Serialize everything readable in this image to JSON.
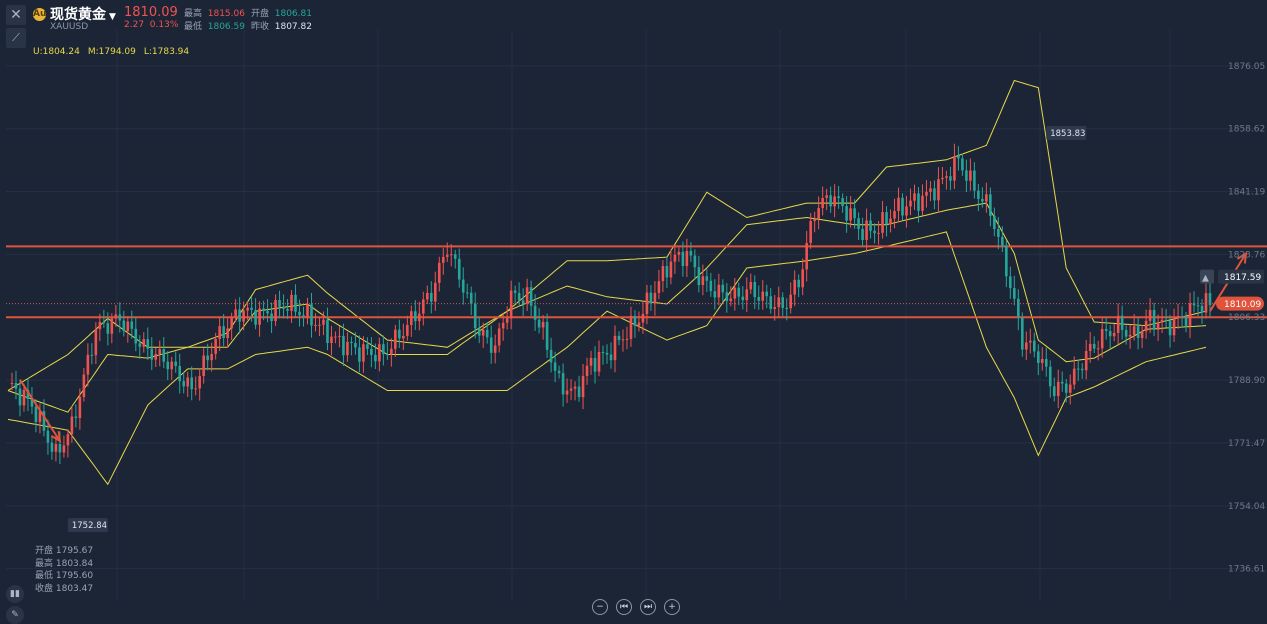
{
  "header": {
    "symbol_name": "现货黄金",
    "symbol_code": "XAUUSD",
    "coin_glyph": "Au",
    "price": "1810.09",
    "change": "2.27",
    "change_pct": "0.13%",
    "high_label": "最高",
    "high_value": "1815.06",
    "open_label": "开盘",
    "open_value": "1806.81",
    "low_label": "最低",
    "low_value": "1806.59",
    "prev_label": "昨收",
    "prev_value": "1807.82"
  },
  "bollinger": {
    "upper": "U:1804.24",
    "middle": "M:1794.09",
    "lower": "L:1783.94"
  },
  "ohlc_panel": {
    "open": "开盘 1795.67",
    "high": "最高 1803.84",
    "low": "最低 1795.60",
    "close": "收盘 1803.47"
  },
  "tags": {
    "crosshair_price": "1817.59",
    "current_price": "1810.09",
    "high_marker": "1853.83",
    "low_marker": "1752.84"
  },
  "colors": {
    "background": "#1c2536",
    "up": "#ef5350",
    "down": "#26a69a",
    "bands": "#e8d84a",
    "resistance": "#e0533d"
  },
  "icons": [
    "close-icon",
    "draw-tool-icon",
    "bell-icon",
    "zoom-out-icon",
    "scroll-start-icon",
    "scroll-end-icon",
    "zoom-in-icon"
  ],
  "chart_data": {
    "type": "candlestick",
    "symbol": "XAUUSD",
    "y_ticks": [
      "1876.05",
      "1858.62",
      "1841.19",
      "1823.76",
      "1806.33",
      "1788.90",
      "1771.47",
      "1754.04",
      "1736.61"
    ],
    "ylim": [
      1727.9,
      1886.0
    ],
    "grid": true,
    "horizontal_lines": [
      1826.0,
      1806.33
    ],
    "arrows": [
      {
        "from": [
          3,
          1789
        ],
        "to": [
          13,
          1772
        ]
      },
      {
        "from": [
          301,
          1808
        ],
        "to": [
          310,
          1824
        ]
      }
    ],
    "bands": {
      "upper": [
        [
          0,
          1786
        ],
        [
          15,
          1796
        ],
        [
          25,
          1806
        ],
        [
          35,
          1798
        ],
        [
          45,
          1798
        ],
        [
          55,
          1802
        ],
        [
          62,
          1814
        ],
        [
          75,
          1818
        ],
        [
          80,
          1813
        ],
        [
          95,
          1800
        ],
        [
          110,
          1798
        ],
        [
          125,
          1808
        ],
        [
          140,
          1822
        ],
        [
          150,
          1822
        ],
        [
          165,
          1823
        ],
        [
          175,
          1841
        ],
        [
          185,
          1834
        ],
        [
          200,
          1838
        ],
        [
          212,
          1838
        ],
        [
          220,
          1848
        ],
        [
          235,
          1850
        ],
        [
          245,
          1854
        ],
        [
          252,
          1872
        ],
        [
          258,
          1870
        ],
        [
          265,
          1820
        ],
        [
          272,
          1805
        ],
        [
          285,
          1804
        ],
        [
          300,
          1808
        ]
      ],
      "middle": [
        [
          0,
          1786
        ],
        [
          15,
          1780
        ],
        [
          25,
          1796
        ],
        [
          35,
          1795
        ],
        [
          45,
          1798
        ],
        [
          55,
          1798
        ],
        [
          62,
          1808
        ],
        [
          75,
          1810
        ],
        [
          80,
          1806
        ],
        [
          95,
          1796
        ],
        [
          110,
          1796
        ],
        [
          125,
          1808
        ],
        [
          140,
          1815
        ],
        [
          150,
          1812
        ],
        [
          165,
          1810
        ],
        [
          175,
          1820
        ],
        [
          185,
          1832
        ],
        [
          200,
          1834
        ],
        [
          212,
          1832
        ],
        [
          220,
          1832
        ],
        [
          235,
          1836
        ],
        [
          245,
          1838
        ],
        [
          252,
          1824
        ],
        [
          258,
          1800
        ],
        [
          265,
          1794
        ],
        [
          272,
          1795
        ],
        [
          285,
          1803
        ],
        [
          300,
          1804
        ]
      ],
      "lower": [
        [
          0,
          1778
        ],
        [
          15,
          1775
        ],
        [
          25,
          1760
        ],
        [
          35,
          1782
        ],
        [
          45,
          1792
        ],
        [
          55,
          1792
        ],
        [
          62,
          1796
        ],
        [
          75,
          1798
        ],
        [
          80,
          1796
        ],
        [
          95,
          1786
        ],
        [
          110,
          1786
        ],
        [
          125,
          1786
        ],
        [
          140,
          1798
        ],
        [
          150,
          1808
        ],
        [
          165,
          1800
        ],
        [
          175,
          1804
        ],
        [
          185,
          1820
        ],
        [
          200,
          1822
        ],
        [
          212,
          1824
        ],
        [
          220,
          1826
        ],
        [
          235,
          1830
        ],
        [
          245,
          1798
        ],
        [
          252,
          1784
        ],
        [
          258,
          1768
        ],
        [
          265,
          1784
        ],
        [
          272,
          1787
        ],
        [
          285,
          1794
        ],
        [
          300,
          1798
        ]
      ]
    },
    "price_path": [
      [
        0,
        1788
      ],
      [
        6,
        1782
      ],
      [
        12,
        1768
      ],
      [
        16,
        1776
      ],
      [
        22,
        1803
      ],
      [
        28,
        1806
      ],
      [
        34,
        1798
      ],
      [
        40,
        1794
      ],
      [
        46,
        1786
      ],
      [
        52,
        1800
      ],
      [
        58,
        1808
      ],
      [
        64,
        1807
      ],
      [
        70,
        1810
      ],
      [
        76,
        1806
      ],
      [
        82,
        1800
      ],
      [
        88,
        1797
      ],
      [
        94,
        1796
      ],
      [
        100,
        1804
      ],
      [
        106,
        1813
      ],
      [
        110,
        1826
      ],
      [
        114,
        1815
      ],
      [
        118,
        1802
      ],
      [
        122,
        1798
      ],
      [
        126,
        1812
      ],
      [
        130,
        1812
      ],
      [
        134,
        1802
      ],
      [
        138,
        1788
      ],
      [
        142,
        1785
      ],
      [
        146,
        1794
      ],
      [
        150,
        1796
      ],
      [
        154,
        1801
      ],
      [
        158,
        1806
      ],
      [
        162,
        1814
      ],
      [
        166,
        1822
      ],
      [
        170,
        1824
      ],
      [
        174,
        1816
      ],
      [
        178,
        1813
      ],
      [
        182,
        1812
      ],
      [
        186,
        1814
      ],
      [
        190,
        1811
      ],
      [
        194,
        1809
      ],
      [
        198,
        1816
      ],
      [
        202,
        1836
      ],
      [
        206,
        1840
      ],
      [
        210,
        1836
      ],
      [
        214,
        1830
      ],
      [
        218,
        1831
      ],
      [
        222,
        1836
      ],
      [
        226,
        1838
      ],
      [
        230,
        1840
      ],
      [
        234,
        1844
      ],
      [
        238,
        1850
      ],
      [
        242,
        1842
      ],
      [
        246,
        1836
      ],
      [
        250,
        1820
      ],
      [
        254,
        1800
      ],
      [
        258,
        1796
      ],
      [
        262,
        1786
      ],
      [
        266,
        1788
      ],
      [
        270,
        1796
      ],
      [
        274,
        1801
      ],
      [
        278,
        1804
      ],
      [
        282,
        1801
      ],
      [
        286,
        1806
      ],
      [
        290,
        1804
      ],
      [
        294,
        1806
      ],
      [
        298,
        1810
      ],
      [
        301,
        1810
      ]
    ]
  }
}
